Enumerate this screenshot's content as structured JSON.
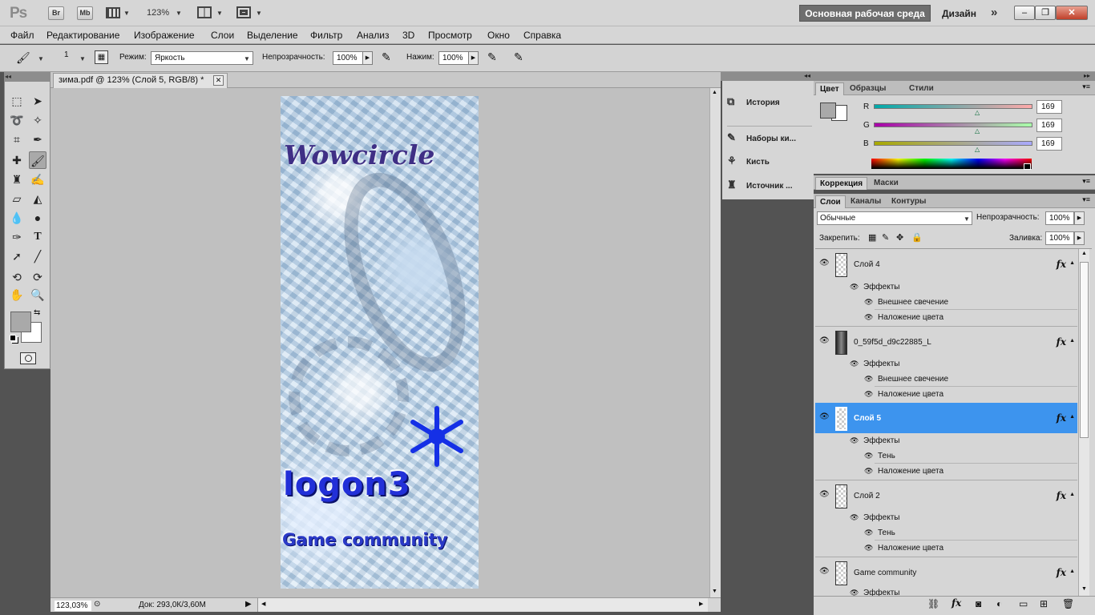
{
  "appbar": {
    "logo": "Ps",
    "bridge": "Br",
    "minibridge": "Mb",
    "zoom": "123%",
    "workspace_active": "Основная рабочая среда",
    "workspace_design": "Дизайн",
    "more": "»"
  },
  "menu": [
    "Файл",
    "Редактирование",
    "Изображение",
    "Слои",
    "Выделение",
    "Фильтр",
    "Анализ",
    "3D",
    "Просмотр",
    "Окно",
    "Справка"
  ],
  "options": {
    "brush_size": "1",
    "mode_label": "Режим:",
    "mode_value": "Яркость",
    "opacity_label": "Непрозрачность:",
    "opacity_value": "100%",
    "pressure_label": "Нажим:",
    "pressure_value": "100%"
  },
  "document": {
    "tab_title": "зима.pdf @ 123% (Слой 5, RGB/8) *",
    "zoom_status": "123,03%",
    "doc_size": "Док: 293,0К/3,60М",
    "art_title": "Wowcircle",
    "art_logo": "logon3",
    "art_sub": "Game community"
  },
  "dock": [
    "История",
    "Наборы ки...",
    "Кисть",
    "Источник ..."
  ],
  "color_panel": {
    "tabs": [
      "Цвет",
      "Образцы",
      "Стили"
    ],
    "r_label": "R",
    "g_label": "G",
    "b_label": "B",
    "r": "169",
    "g": "169",
    "b": "169",
    "fg_color": "#a9a9a9"
  },
  "adjust_tabs": [
    "Коррекция",
    "Маски"
  ],
  "layers_panel": {
    "tabs": [
      "Слои",
      "Каналы",
      "Контуры"
    ],
    "blend_mode": "Обычные",
    "opacity_label": "Непрозрачность:",
    "opacity": "100%",
    "lock_label": "Закрепить:",
    "fill_label": "Заливка:",
    "fill": "100%",
    "layers": [
      {
        "name": "Слой 4",
        "effects_label": "Эффекты",
        "effects": [
          "Внешнее свечение",
          "Наложение цвета"
        ]
      },
      {
        "name": "0_59f5d_d9c22885_L",
        "effects_label": "Эффекты",
        "effects": [
          "Внешнее свечение",
          "Наложение цвета"
        ]
      },
      {
        "name": "Слой 5",
        "effects_label": "Эффекты",
        "effects": [
          "Тень",
          "Наложение цвета"
        ]
      },
      {
        "name": "Слой 2",
        "effects_label": "Эффекты",
        "effects": [
          "Тень",
          "Наложение цвета"
        ]
      },
      {
        "name": "Game community",
        "effects_label": "Эффекты",
        "effects": []
      }
    ]
  }
}
